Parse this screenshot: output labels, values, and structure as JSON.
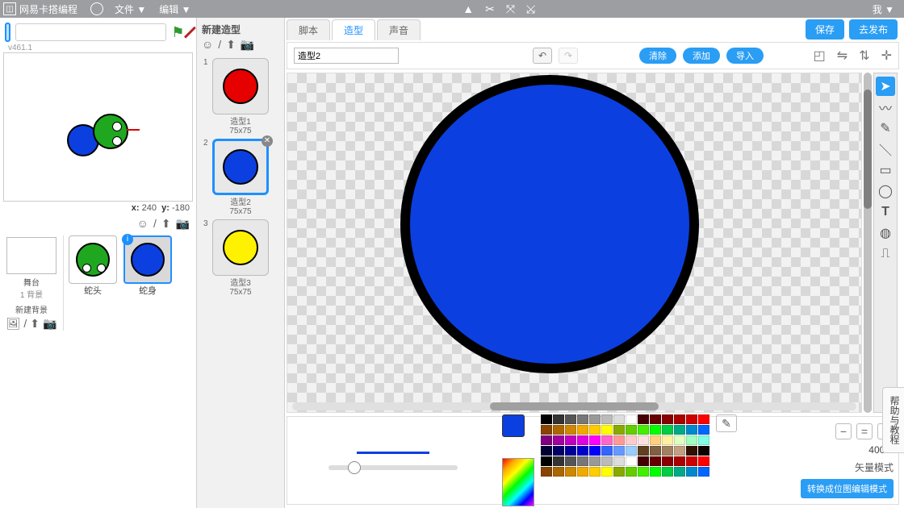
{
  "menubar": {
    "brand": "网易卡搭编程",
    "file": "文件 ▼",
    "edit": "编辑 ▼",
    "me": "我 ▼"
  },
  "left": {
    "version": "v461.1",
    "title_placeholder": "",
    "coords": {
      "xlabel": "x:",
      "x": "240",
      "ylabel": "y:",
      "y": "-180"
    },
    "stage": {
      "label": "舞台",
      "sub": "1 背景"
    },
    "new_bg": "新建背景",
    "sprites": [
      {
        "label": "蛇头"
      },
      {
        "label": "蛇身"
      }
    ]
  },
  "costumes": {
    "heading": "新建造型",
    "items": [
      {
        "num": "1",
        "name": "造型1",
        "size": "75x75"
      },
      {
        "num": "2",
        "name": "造型2",
        "size": "75x75"
      },
      {
        "num": "3",
        "name": "造型3",
        "size": "75x75"
      }
    ]
  },
  "tabs": {
    "scripts": "脚本",
    "costumes": "造型",
    "sounds": "声音"
  },
  "actions": {
    "save": "保存",
    "publish": "去发布"
  },
  "editor": {
    "name_value": "造型2",
    "clear": "清除",
    "add": "添加",
    "import": "导入"
  },
  "bottom": {
    "zoom": "400%",
    "mode_label": "矢量模式",
    "mode_button": "转换成位图编辑模式"
  },
  "help": "帮助与教程"
}
